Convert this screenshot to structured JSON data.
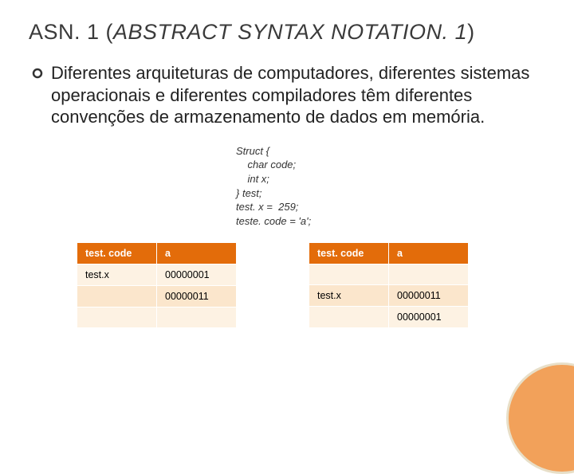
{
  "title_plain": "ASN. 1 (",
  "title_italic": "ABSTRACT SYNTAX NOTATION. 1",
  "title_close": ")",
  "bullet": "Diferentes arquiteturas de computadores, diferentes sistemas operacionais e diferentes compiladores têm diferentes convenções de armazenamento de dados em memória.",
  "code": "Struct {\n    char code;\n    int x;\n} test;\ntest. x =  259;\nteste. code = 'a';",
  "table1": {
    "h1": "test. code",
    "h2": "a",
    "r1c1": "test.x",
    "r1c2": "00000001",
    "r2c1": "",
    "r2c2": "00000011",
    "r3c1": "",
    "r3c2": ""
  },
  "table2": {
    "h1": "test. code",
    "h2": "a",
    "r1c1": "",
    "r1c2": "",
    "r2c1": "test.x",
    "r2c2": "00000011",
    "r3c1": "",
    "r3c2": "00000001"
  }
}
